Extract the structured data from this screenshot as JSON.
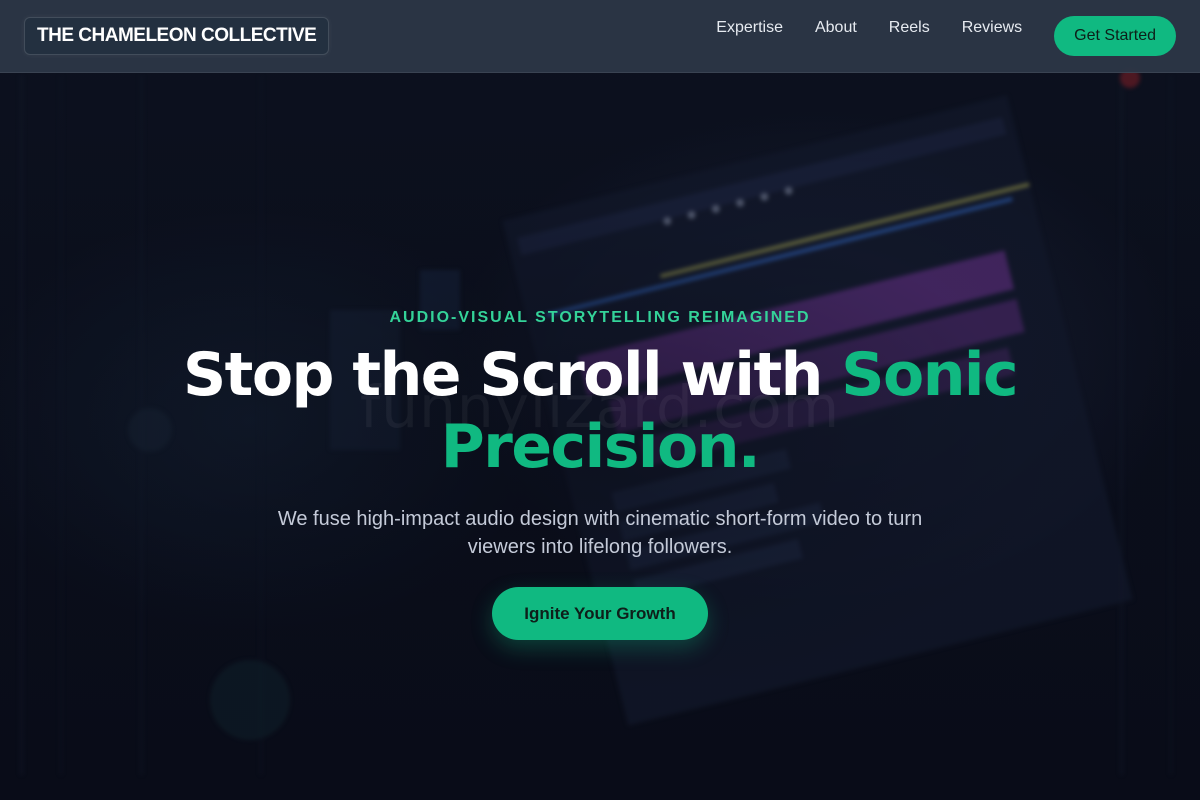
{
  "header": {
    "brand": "THE CHAMELEON COLLECTIVE",
    "nav": [
      {
        "label": "Expertise"
      },
      {
        "label": "About"
      },
      {
        "label": "Reels"
      },
      {
        "label": "Reviews"
      }
    ],
    "cta_label": "Get Started"
  },
  "hero": {
    "eyebrow": "AUDIO-VISUAL STORYTELLING REIMAGINED",
    "headline_main": "Stop the Scroll with ",
    "headline_accent": "Sonic Precision.",
    "subheadline": "We fuse high-impact audio design with cinematic short-form video to turn viewers into lifelong followers.",
    "cta_label": "Ignite Your Growth",
    "watermark": "funnylizard.com"
  },
  "colors": {
    "accent": "#10b981",
    "eyebrow": "#34d399",
    "header_bg": "#2c3646",
    "page_bg": "#0b0f1c",
    "text_primary": "#ffffff",
    "text_secondary": "#c4cad8"
  }
}
